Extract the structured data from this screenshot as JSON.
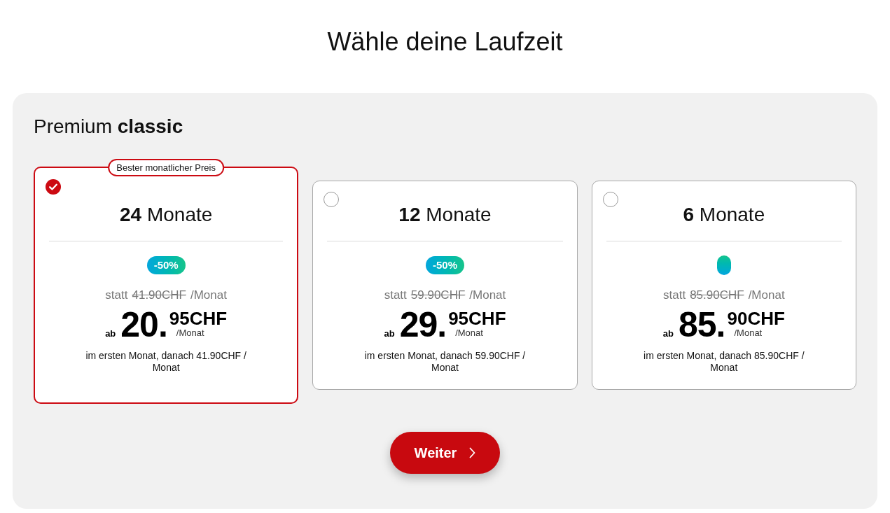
{
  "heading": "Wähle deine Laufzeit",
  "plan": {
    "title": "Premium **classic**",
    "options": [
      {
        "selected": true,
        "tag": "Bester monatlicher Preis",
        "title": "**24** Monate",
        "discount": "-50%",
        "was_label": "statt",
        "old_price": "41.90CHF",
        "was_unit": "/Monat",
        "price_prefix": "ab",
        "price_main": "20.",
        "price_cents": "95CHF",
        "price_unit": "/Monat",
        "note": "im ersten Monat, danach 41.90CHF / Monat"
      },
      {
        "selected": false,
        "title": "**12** Monate",
        "discount": "-50%",
        "was_label": "statt",
        "old_price": "59.90CHF",
        "was_unit": "/Monat",
        "price_prefix": "ab",
        "price_main": "29.",
        "price_cents": "95CHF",
        "price_unit": "/Monat",
        "note": "im ersten Monat, danach 59.90CHF / Monat"
      },
      {
        "selected": false,
        "title": "**6** Monate",
        "was_label": "statt",
        "old_price": "85.90CHF",
        "was_unit": "/Monat",
        "price_prefix": "ab",
        "price_main": "85.",
        "price_cents": "90CHF",
        "price_unit": "/Monat",
        "note": "im ersten Monat, danach 85.90CHF / Monat"
      }
    ]
  },
  "button": {
    "label": "Weiter"
  }
}
